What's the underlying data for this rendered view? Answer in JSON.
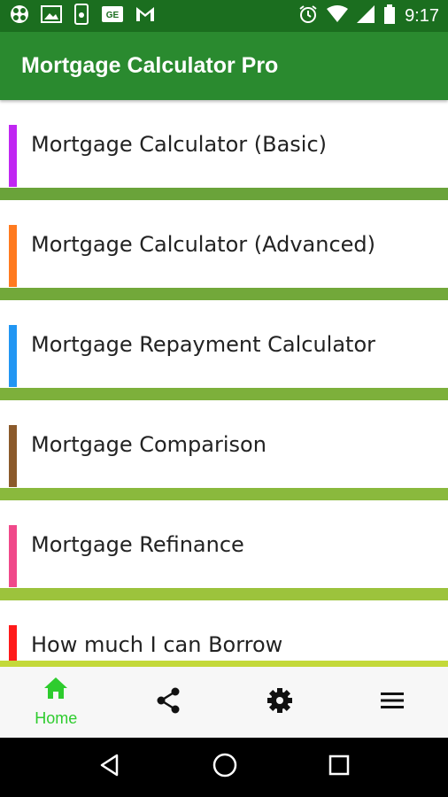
{
  "status_bar": {
    "time": "9:17",
    "left_icons": [
      "pinwheel-icon",
      "image-icon",
      "phone-icon",
      "ge-icon",
      "gmail-icon"
    ],
    "right_icons": [
      "alarm-icon",
      "wifi-icon",
      "signal-icon",
      "battery-icon"
    ]
  },
  "app_bar": {
    "title": "Mortgage Calculator Pro"
  },
  "menu": {
    "items": [
      {
        "label": "Mortgage Calculator (Basic)",
        "accent": "#c026f2",
        "divider": "#6aa33a"
      },
      {
        "label": "Mortgage Calculator (Advanced)",
        "accent": "#ff7a1f",
        "divider": "#72a83a"
      },
      {
        "label": "Mortgage Repayment Calculator",
        "accent": "#2196f3",
        "divider": "#7db03b"
      },
      {
        "label": "Mortgage Comparison",
        "accent": "#8b5a2b",
        "divider": "#8ab93d"
      },
      {
        "label": "Mortgage Refinance",
        "accent": "#f0498a",
        "divider": "#9cc33c"
      },
      {
        "label": "How much I can Borrow",
        "accent": "#ff1a1a",
        "divider": "#c4d93a"
      }
    ]
  },
  "bottom_nav": {
    "home_label": "Home",
    "active_color": "#2ecc2e",
    "items": [
      "home-icon",
      "share-icon",
      "settings-icon",
      "menu-icon"
    ]
  },
  "system_nav": {
    "items": [
      "back-icon",
      "home-circle-icon",
      "recents-icon"
    ]
  }
}
